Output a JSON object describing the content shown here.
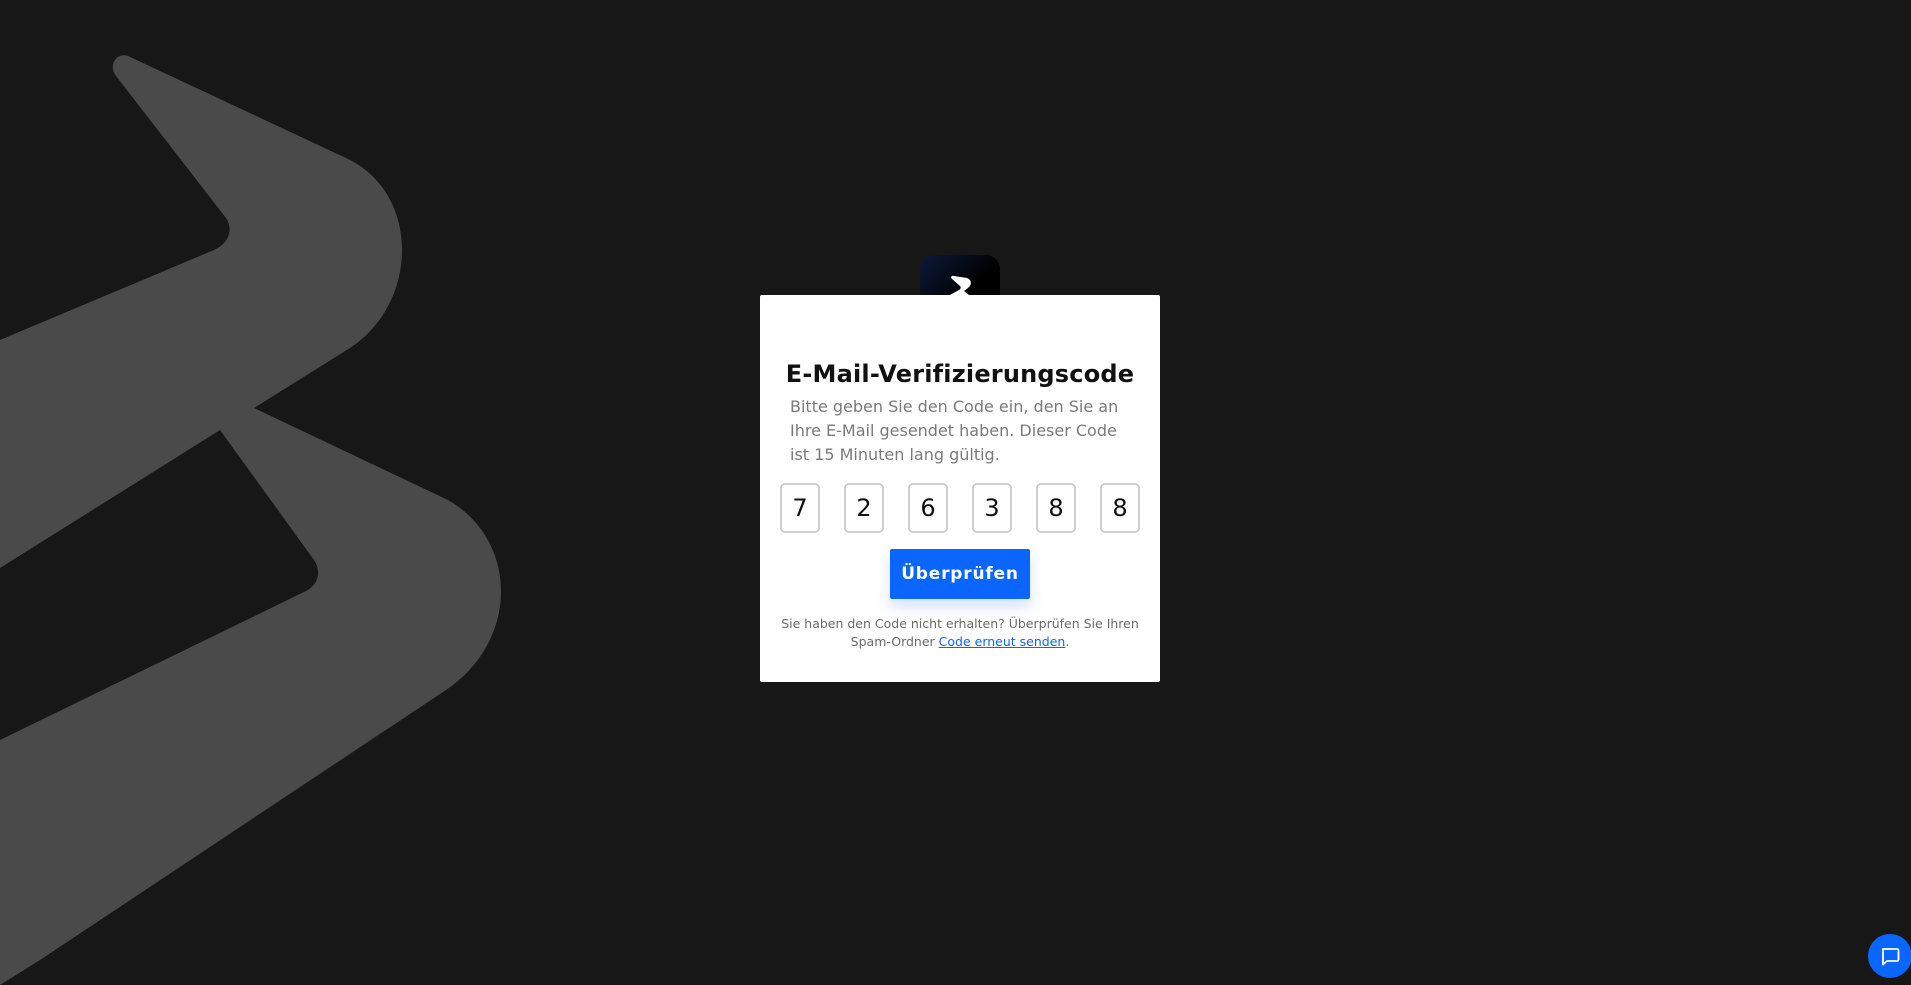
{
  "background": {
    "color": "#171717",
    "logo_color": "#4a4a4a",
    "icon": "brand-logo-watermark"
  },
  "app_logo": {
    "icon": "brand-logo-icon",
    "color": "#000000"
  },
  "dialog": {
    "title": "E-Mail-Verifizierungscode",
    "description": "Bitte geben Sie den Code ein, den Sie an Ihre E-Mail gesendet haben. Dieser Code ist 15 Minuten lang gültig.",
    "code_digits": [
      "7",
      "2",
      "6",
      "3",
      "8",
      "8"
    ],
    "verify_label": "Überprüfen",
    "hint_text": "Sie haben den Code nicht erhalten? Überprüfen Sie Ihren Spam-Ordner ",
    "resend_link": "Code erneut senden",
    "hint_end": ".",
    "accent_color": "#0a66ff"
  },
  "chat": {
    "icon": "chat-icon"
  }
}
